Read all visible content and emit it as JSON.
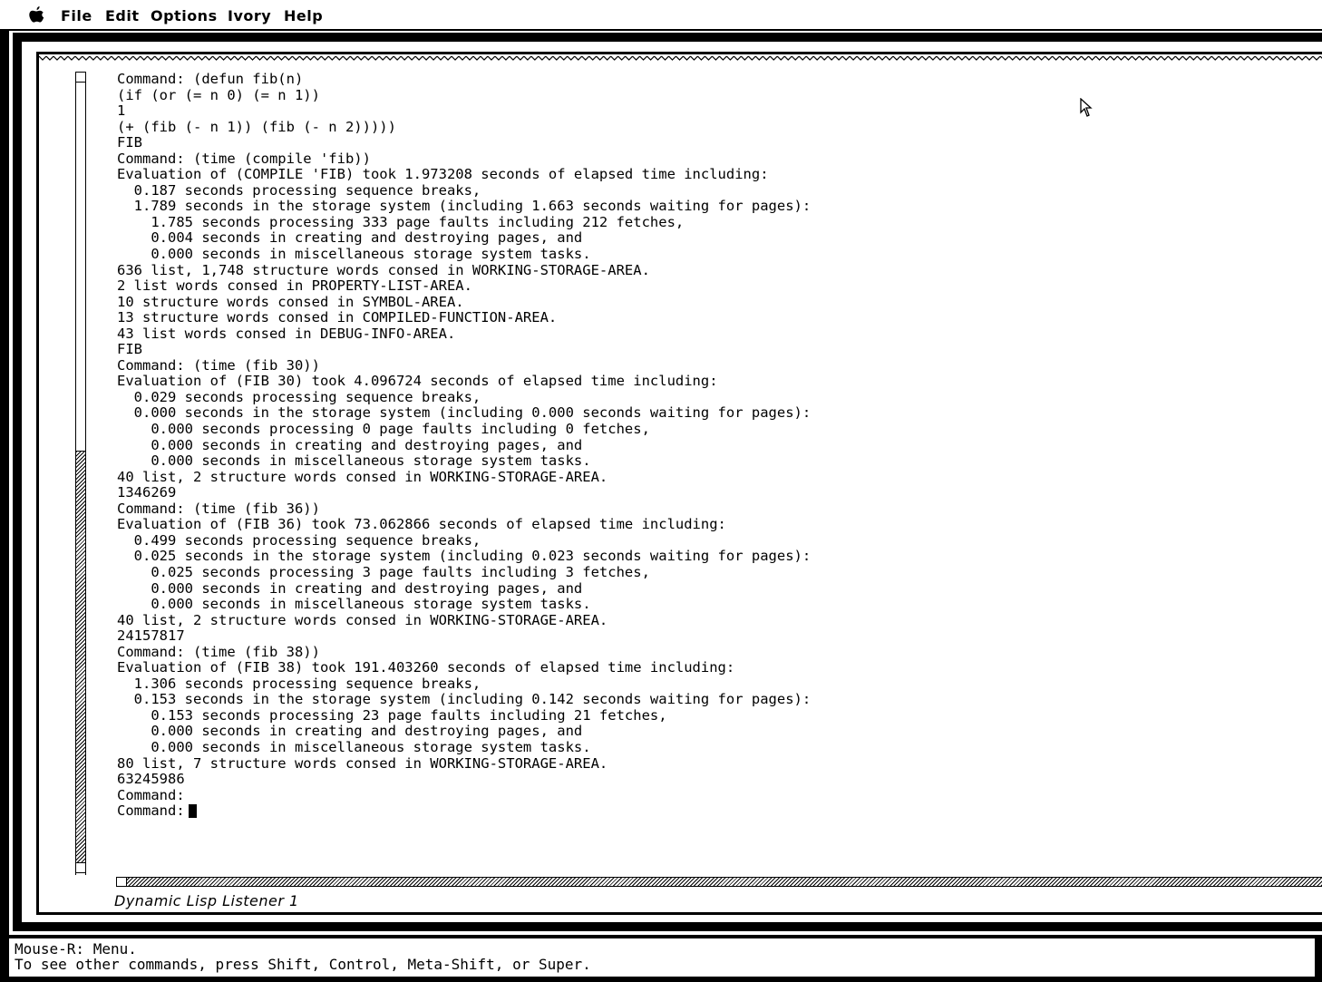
{
  "menubar": {
    "apple_icon": "apple-logo-icon",
    "items": [
      "File",
      "Edit",
      "Options",
      "Ivory",
      "Help"
    ]
  },
  "listener": {
    "lines": [
      "Command: (defun fib(n)",
      "(if (or (= n 0) (= n 1))",
      "1",
      "(+ (fib (- n 1)) (fib (- n 2)))))",
      "FIB",
      "Command: (time (compile 'fib))",
      "Evaluation of (COMPILE 'FIB) took 1.973208 seconds of elapsed time including:",
      "  0.187 seconds processing sequence breaks,",
      "  1.789 seconds in the storage system (including 1.663 seconds waiting for pages):",
      "    1.785 seconds processing 333 page faults including 212 fetches,",
      "    0.004 seconds in creating and destroying pages, and",
      "    0.000 seconds in miscellaneous storage system tasks.",
      "636 list, 1,748 structure words consed in WORKING-STORAGE-AREA.",
      "2 list words consed in PROPERTY-LIST-AREA.",
      "10 structure words consed in SYMBOL-AREA.",
      "13 structure words consed in COMPILED-FUNCTION-AREA.",
      "43 list words consed in DEBUG-INFO-AREA.",
      "FIB",
      "Command: (time (fib 30))",
      "Evaluation of (FIB 30) took 4.096724 seconds of elapsed time including:",
      "  0.029 seconds processing sequence breaks,",
      "  0.000 seconds in the storage system (including 0.000 seconds waiting for pages):",
      "    0.000 seconds processing 0 page faults including 0 fetches,",
      "    0.000 seconds in creating and destroying pages, and",
      "    0.000 seconds in miscellaneous storage system tasks.",
      "40 list, 2 structure words consed in WORKING-STORAGE-AREA.",
      "1346269",
      "Command: (time (fib 36))",
      "Evaluation of (FIB 36) took 73.062866 seconds of elapsed time including:",
      "  0.499 seconds processing sequence breaks,",
      "  0.025 seconds in the storage system (including 0.023 seconds waiting for pages):",
      "    0.025 seconds processing 3 page faults including 3 fetches,",
      "    0.000 seconds in creating and destroying pages, and",
      "    0.000 seconds in miscellaneous storage system tasks.",
      "40 list, 2 structure words consed in WORKING-STORAGE-AREA.",
      "24157817",
      "Command: (time (fib 38))",
      "Evaluation of (FIB 38) took 191.403260 seconds of elapsed time including:",
      "  1.306 seconds processing sequence breaks,",
      "  0.153 seconds in the storage system (including 0.142 seconds waiting for pages):",
      "    0.153 seconds processing 23 page faults including 21 fetches,",
      "    0.000 seconds in creating and destroying pages, and",
      "    0.000 seconds in miscellaneous storage system tasks.",
      "80 list, 7 structure words consed in WORKING-STORAGE-AREA.",
      "63245986",
      "Command:"
    ],
    "prompt": "Command:",
    "pane_label": "Dynamic Lisp Listener 1"
  },
  "mouse_doc": {
    "line1": "Mouse-R: Menu.",
    "line2": "To see other commands, press Shift, Control, Meta-Shift, or Super."
  }
}
